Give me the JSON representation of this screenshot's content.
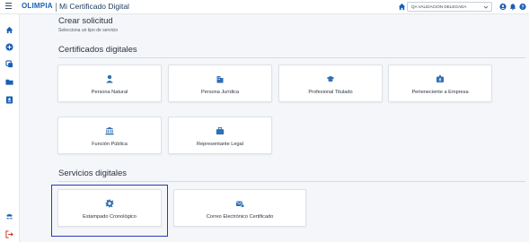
{
  "header": {
    "logo_text": "OLIMPIA",
    "app_title": "Mi Certificado Digital",
    "org_selector_value": "QA VALIDACION DELEGADA",
    "icons": [
      "home-icon",
      "user-circle-icon",
      "bell-icon",
      "help-icon"
    ]
  },
  "sidebar": {
    "icons": [
      "home-icon",
      "add-circle-icon",
      "copy-icon",
      "folder-icon",
      "id-card-icon",
      "users-icon",
      "logout-icon"
    ]
  },
  "page": {
    "title": "Crear solicitud",
    "subtitle": "Selecciona un tipo de servicio"
  },
  "certificados": {
    "title": "Certificados digitales",
    "cards": [
      {
        "label": "Persona Natural",
        "icon": "person-icon"
      },
      {
        "label": "Persona Jurídica",
        "icon": "building-icon"
      },
      {
        "label": "Profesional Titulado",
        "icon": "graduation-cap-icon"
      },
      {
        "label": "Perteneciente a Empresa",
        "icon": "badge-icon"
      },
      {
        "label": "Función Pública",
        "icon": "institution-icon"
      },
      {
        "label": "Representante Legal",
        "icon": "briefcase-icon"
      }
    ]
  },
  "servicios": {
    "title": "Servicios digitales",
    "cards": [
      {
        "label": "Estampado Cronológico",
        "icon": "gear-icon"
      },
      {
        "label": "Correo Electrónico Certificado",
        "icon": "mail-certified-icon"
      }
    ]
  },
  "colors": {
    "accent": "#1a5fb4",
    "card_icon": "#2f6fb5",
    "highlight_border": "#2a3bb8",
    "logout": "#d0342c"
  }
}
